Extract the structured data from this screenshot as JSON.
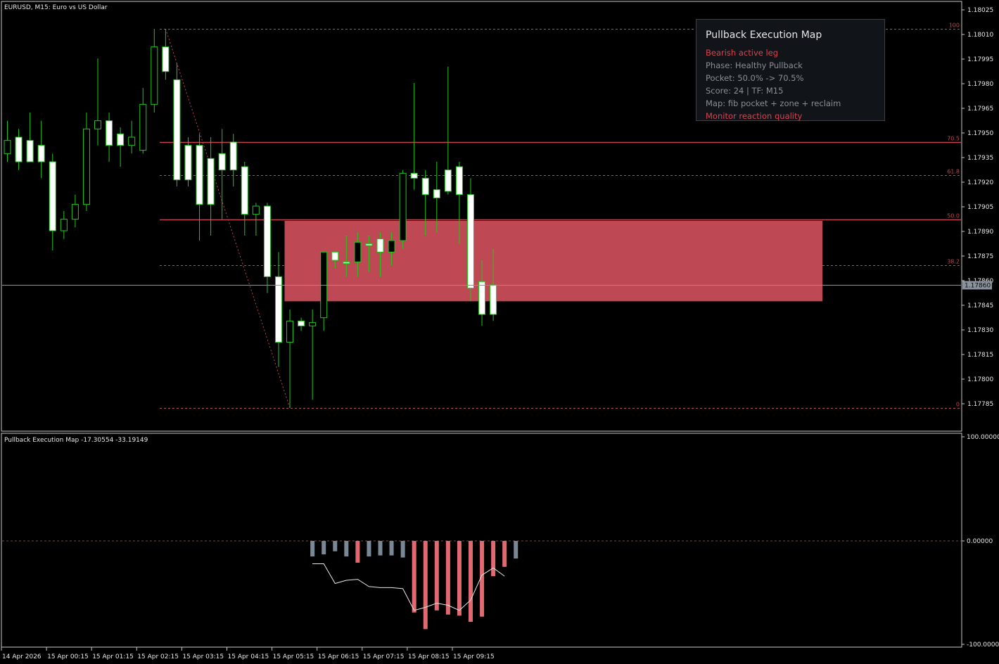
{
  "chart_title": "EURUSD, M15:  Euro vs US Dollar",
  "indicator_title": "Pullback Execution Map -17.30554 -33.19149",
  "price_axis_labels": [
    "1.18025",
    "1.18010",
    "1.17995",
    "1.17980",
    "1.17965",
    "1.17950",
    "1.17935",
    "1.17920",
    "1.17905",
    "1.17890",
    "1.17875",
    "1.17860",
    "1.17845",
    "1.17830",
    "1.17815",
    "1.17800",
    "1.17785"
  ],
  "indicator_axis_labels": [
    "100.00000",
    "0.00000",
    "-100.00000"
  ],
  "time_axis_labels": [
    "14 Apr 2026",
    "15 Apr 00:15",
    "15 Apr 01:15",
    "15 Apr 02:15",
    "15 Apr 03:15",
    "15 Apr 04:15",
    "15 Apr 05:15",
    "15 Apr 06:15",
    "15 Apr 07:15",
    "15 Apr 08:15",
    "15 Apr 09:15"
  ],
  "current_price": "1.17860",
  "panel": {
    "title": "Pullback Execution Map",
    "leg": "Bearish active leg",
    "phase": "Phase: Healthy Pullback",
    "pocket": "Pocket: 50.0% -> 70.5%",
    "score": "Score: 24  |  TF: M15",
    "map": "Map: fib pocket + zone + reclaim",
    "action": "Monitor reaction quality"
  },
  "colors": {
    "background": "#000000",
    "candle_up": "#000000",
    "candle_down": "#ffffff",
    "wick": "#22c81e",
    "fib": "#c0454f",
    "zone": "#c24a56",
    "hist_neutral": "#7a8794",
    "hist_bear": "#e06a6f",
    "signal_line": "#e8e8e8",
    "panel_accent": "#d9434f"
  },
  "chart_data": [
    {
      "type": "candlestick",
      "title": "EURUSD, M15:  Euro vs US Dollar",
      "ylim": [
        1.17778,
        1.18032
      ],
      "current_price": 1.1786,
      "fib_levels": [
        {
          "label": "100",
          "value": 1.18016,
          "style": "dashed"
        },
        {
          "label": "70.5",
          "value": 1.17947,
          "style": "solid"
        },
        {
          "label": "61.8",
          "value": 1.17927,
          "style": "dashed"
        },
        {
          "label": "50.0",
          "value": 1.179,
          "style": "solid"
        },
        {
          "label": "38.2",
          "value": 1.17872,
          "style": "dashed"
        },
        {
          "label": "0",
          "value": 1.17785,
          "style": "dashed"
        }
      ],
      "zone": {
        "top": 1.17899,
        "bottom": 1.1785,
        "start_index": 25,
        "end_index": 72
      },
      "leg": {
        "from_index": 14,
        "from_price": 1.18016,
        "to_index": 25,
        "to_price": 1.17785
      },
      "candles": [
        {
          "o": 1.1794,
          "h": 1.1796,
          "l": 1.17935,
          "c": 1.17948
        },
        {
          "o": 1.1795,
          "h": 1.17955,
          "l": 1.1793,
          "c": 1.17935
        },
        {
          "o": 1.17948,
          "h": 1.17965,
          "l": 1.17935,
          "c": 1.17935
        },
        {
          "o": 1.17945,
          "h": 1.1796,
          "l": 1.17925,
          "c": 1.17935
        },
        {
          "o": 1.17935,
          "h": 1.1794,
          "l": 1.17881,
          "c": 1.17893
        },
        {
          "o": 1.17893,
          "h": 1.17905,
          "l": 1.17888,
          "c": 1.179
        },
        {
          "o": 1.179,
          "h": 1.17915,
          "l": 1.17895,
          "c": 1.17909
        },
        {
          "o": 1.17909,
          "h": 1.17965,
          "l": 1.17905,
          "c": 1.17955
        },
        {
          "o": 1.17955,
          "h": 1.17998,
          "l": 1.17945,
          "c": 1.1796
        },
        {
          "o": 1.1796,
          "h": 1.17965,
          "l": 1.17935,
          "c": 1.17945
        },
        {
          "o": 1.17952,
          "h": 1.17956,
          "l": 1.17932,
          "c": 1.17945
        },
        {
          "o": 1.17945,
          "h": 1.1796,
          "l": 1.1794,
          "c": 1.1795
        },
        {
          "o": 1.17942,
          "h": 1.1798,
          "l": 1.1794,
          "c": 1.1797
        },
        {
          "o": 1.1797,
          "h": 1.18016,
          "l": 1.17965,
          "c": 1.18005
        },
        {
          "o": 1.18005,
          "h": 1.18016,
          "l": 1.17985,
          "c": 1.1799
        },
        {
          "o": 1.17985,
          "h": 1.17995,
          "l": 1.1792,
          "c": 1.17924
        },
        {
          "o": 1.17945,
          "h": 1.1795,
          "l": 1.1792,
          "c": 1.17924
        },
        {
          "o": 1.17945,
          "h": 1.17952,
          "l": 1.17887,
          "c": 1.17909
        },
        {
          "o": 1.17937,
          "h": 1.1795,
          "l": 1.1789,
          "c": 1.17909
        },
        {
          "o": 1.1794,
          "h": 1.17955,
          "l": 1.179,
          "c": 1.1793
        },
        {
          "o": 1.17947,
          "h": 1.17952,
          "l": 1.1792,
          "c": 1.1793
        },
        {
          "o": 1.17932,
          "h": 1.17935,
          "l": 1.1789,
          "c": 1.17903
        },
        {
          "o": 1.17903,
          "h": 1.1791,
          "l": 1.1789,
          "c": 1.17908
        },
        {
          "o": 1.17908,
          "h": 1.1791,
          "l": 1.17855,
          "c": 1.17865
        },
        {
          "o": 1.17865,
          "h": 1.1788,
          "l": 1.1781,
          "c": 1.17825
        },
        {
          "o": 1.17825,
          "h": 1.17845,
          "l": 1.17785,
          "c": 1.17838
        },
        {
          "o": 1.17838,
          "h": 1.1784,
          "l": 1.17832,
          "c": 1.17835
        },
        {
          "o": 1.17835,
          "h": 1.17845,
          "l": 1.1779,
          "c": 1.17837
        },
        {
          "o": 1.1784,
          "h": 1.1788,
          "l": 1.17832,
          "c": 1.1788
        },
        {
          "o": 1.1788,
          "h": 1.1788,
          "l": 1.1787,
          "c": 1.17875
        },
        {
          "o": 1.17874,
          "h": 1.1789,
          "l": 1.17865,
          "c": 1.17873
        },
        {
          "o": 1.17874,
          "h": 1.17892,
          "l": 1.17865,
          "c": 1.17886
        },
        {
          "o": 1.17885,
          "h": 1.1789,
          "l": 1.17868,
          "c": 1.17884
        },
        {
          "o": 1.17888,
          "h": 1.17892,
          "l": 1.17865,
          "c": 1.1788
        },
        {
          "o": 1.1788,
          "h": 1.17892,
          "l": 1.17872,
          "c": 1.17887
        },
        {
          "o": 1.17887,
          "h": 1.1793,
          "l": 1.17882,
          "c": 1.17928
        },
        {
          "o": 1.17928,
          "h": 1.17983,
          "l": 1.17918,
          "c": 1.17925
        },
        {
          "o": 1.17925,
          "h": 1.1793,
          "l": 1.1789,
          "c": 1.17915
        },
        {
          "o": 1.17918,
          "h": 1.17935,
          "l": 1.17892,
          "c": 1.17913
        },
        {
          "o": 1.1793,
          "h": 1.17993,
          "l": 1.17915,
          "c": 1.17917
        },
        {
          "o": 1.17932,
          "h": 1.17935,
          "l": 1.17885,
          "c": 1.17915
        },
        {
          "o": 1.17915,
          "h": 1.17925,
          "l": 1.1785,
          "c": 1.17858
        },
        {
          "o": 1.17862,
          "h": 1.17875,
          "l": 1.17835,
          "c": 1.17842
        },
        {
          "o": 1.1786,
          "h": 1.17882,
          "l": 1.17838,
          "c": 1.17842
        }
      ]
    },
    {
      "type": "bar+line",
      "title": "Pullback Execution Map -17.30554 -33.19149",
      "ylim": [
        -100,
        100
      ],
      "histogram": [
        {
          "index": 27,
          "value": -15,
          "state": "neutral"
        },
        {
          "index": 28,
          "value": -13,
          "state": "neutral"
        },
        {
          "index": 29,
          "value": -10,
          "state": "neutral"
        },
        {
          "index": 30,
          "value": -15,
          "state": "neutral"
        },
        {
          "index": 31,
          "value": -21,
          "state": "bear"
        },
        {
          "index": 32,
          "value": -15,
          "state": "neutral"
        },
        {
          "index": 33,
          "value": -14,
          "state": "neutral"
        },
        {
          "index": 34,
          "value": -14,
          "state": "neutral"
        },
        {
          "index": 35,
          "value": -16,
          "state": "neutral"
        },
        {
          "index": 36,
          "value": -69,
          "state": "bear"
        },
        {
          "index": 37,
          "value": -85,
          "state": "bear"
        },
        {
          "index": 38,
          "value": -67,
          "state": "bear"
        },
        {
          "index": 39,
          "value": -71,
          "state": "bear"
        },
        {
          "index": 40,
          "value": -72,
          "state": "bear"
        },
        {
          "index": 41,
          "value": -78,
          "state": "bear"
        },
        {
          "index": 42,
          "value": -73,
          "state": "bear"
        },
        {
          "index": 43,
          "value": -34,
          "state": "bear"
        },
        {
          "index": 44,
          "value": -25,
          "state": "bear"
        },
        {
          "index": 45,
          "value": -17,
          "state": "neutral"
        }
      ],
      "signal": [
        {
          "index": 27,
          "value": -22
        },
        {
          "index": 28,
          "value": -22
        },
        {
          "index": 29,
          "value": -41
        },
        {
          "index": 30,
          "value": -38
        },
        {
          "index": 31,
          "value": -37
        },
        {
          "index": 32,
          "value": -44
        },
        {
          "index": 33,
          "value": -45
        },
        {
          "index": 34,
          "value": -45
        },
        {
          "index": 35,
          "value": -46
        },
        {
          "index": 36,
          "value": -67
        },
        {
          "index": 37,
          "value": -64
        },
        {
          "index": 38,
          "value": -60
        },
        {
          "index": 39,
          "value": -62
        },
        {
          "index": 40,
          "value": -67
        },
        {
          "index": 41,
          "value": -57
        },
        {
          "index": 42,
          "value": -33
        },
        {
          "index": 43,
          "value": -26
        },
        {
          "index": 44,
          "value": -34
        }
      ]
    }
  ]
}
